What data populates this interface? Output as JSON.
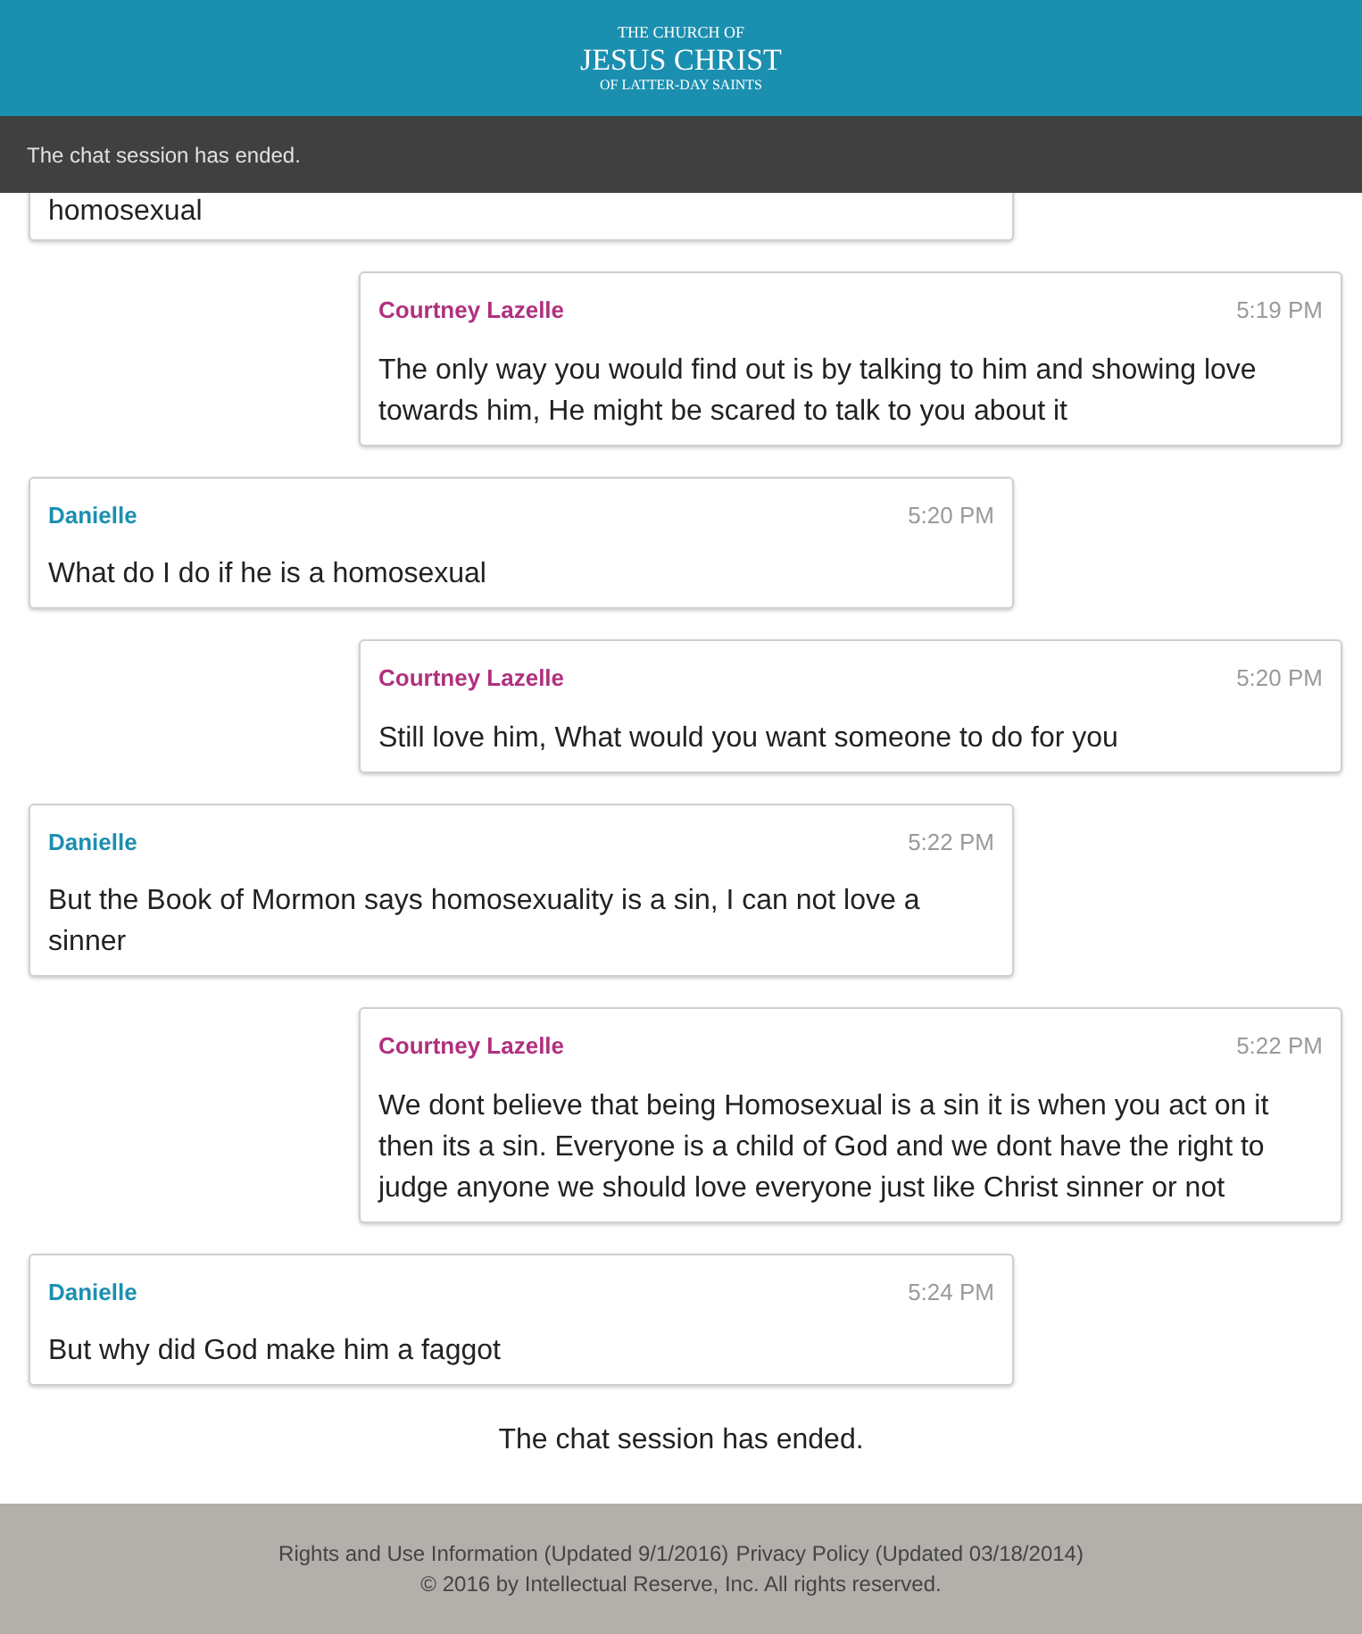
{
  "header": {
    "logo_lines": [
      "THE CHURCH OF",
      "JESUS CHRIST",
      "OF LATTER-DAY SAINTS"
    ]
  },
  "notice_bar": "The chat session has ended.",
  "messages": [
    {
      "kind": "partial",
      "from_agent": false,
      "text": "homosexual"
    },
    {
      "kind": "full",
      "from_agent": true,
      "sender": "Courtney Lazelle",
      "time": "5:19 PM",
      "text": "The only way you would find out is by talking to him and showing love towards him, He might be scared to talk to you about it"
    },
    {
      "kind": "full",
      "from_agent": false,
      "sender": "Danielle",
      "time": "5:20 PM",
      "text": "What do I do if he is a homosexual"
    },
    {
      "kind": "full",
      "from_agent": true,
      "sender": "Courtney Lazelle",
      "time": "5:20 PM",
      "text": "Still love him, What would you want someone to do for you"
    },
    {
      "kind": "full",
      "from_agent": false,
      "sender": "Danielle",
      "time": "5:22 PM",
      "text": "But the Book of Mormon says homosexuality is a sin, I can not love a sinner"
    },
    {
      "kind": "full",
      "from_agent": true,
      "sender": "Courtney Lazelle",
      "time": "5:22 PM",
      "text": "We dont believe that being Homosexual is a sin it is when you act on it then its a sin. Everyone is a child of God and we dont have the right to judge anyone we should love everyone just like Christ sinner or not"
    },
    {
      "kind": "full",
      "from_agent": false,
      "sender": "Danielle",
      "time": "5:24 PM",
      "text": "But why did God make him a faggot"
    }
  ],
  "ended_message": "The chat session has ended.",
  "footer": {
    "links": [
      "Rights and Use Information (Updated 9/1/2016)",
      "Privacy Policy (Updated 03/18/2014)"
    ],
    "copyright": "© 2016 by Intellectual Reserve, Inc. All rights reserved."
  }
}
